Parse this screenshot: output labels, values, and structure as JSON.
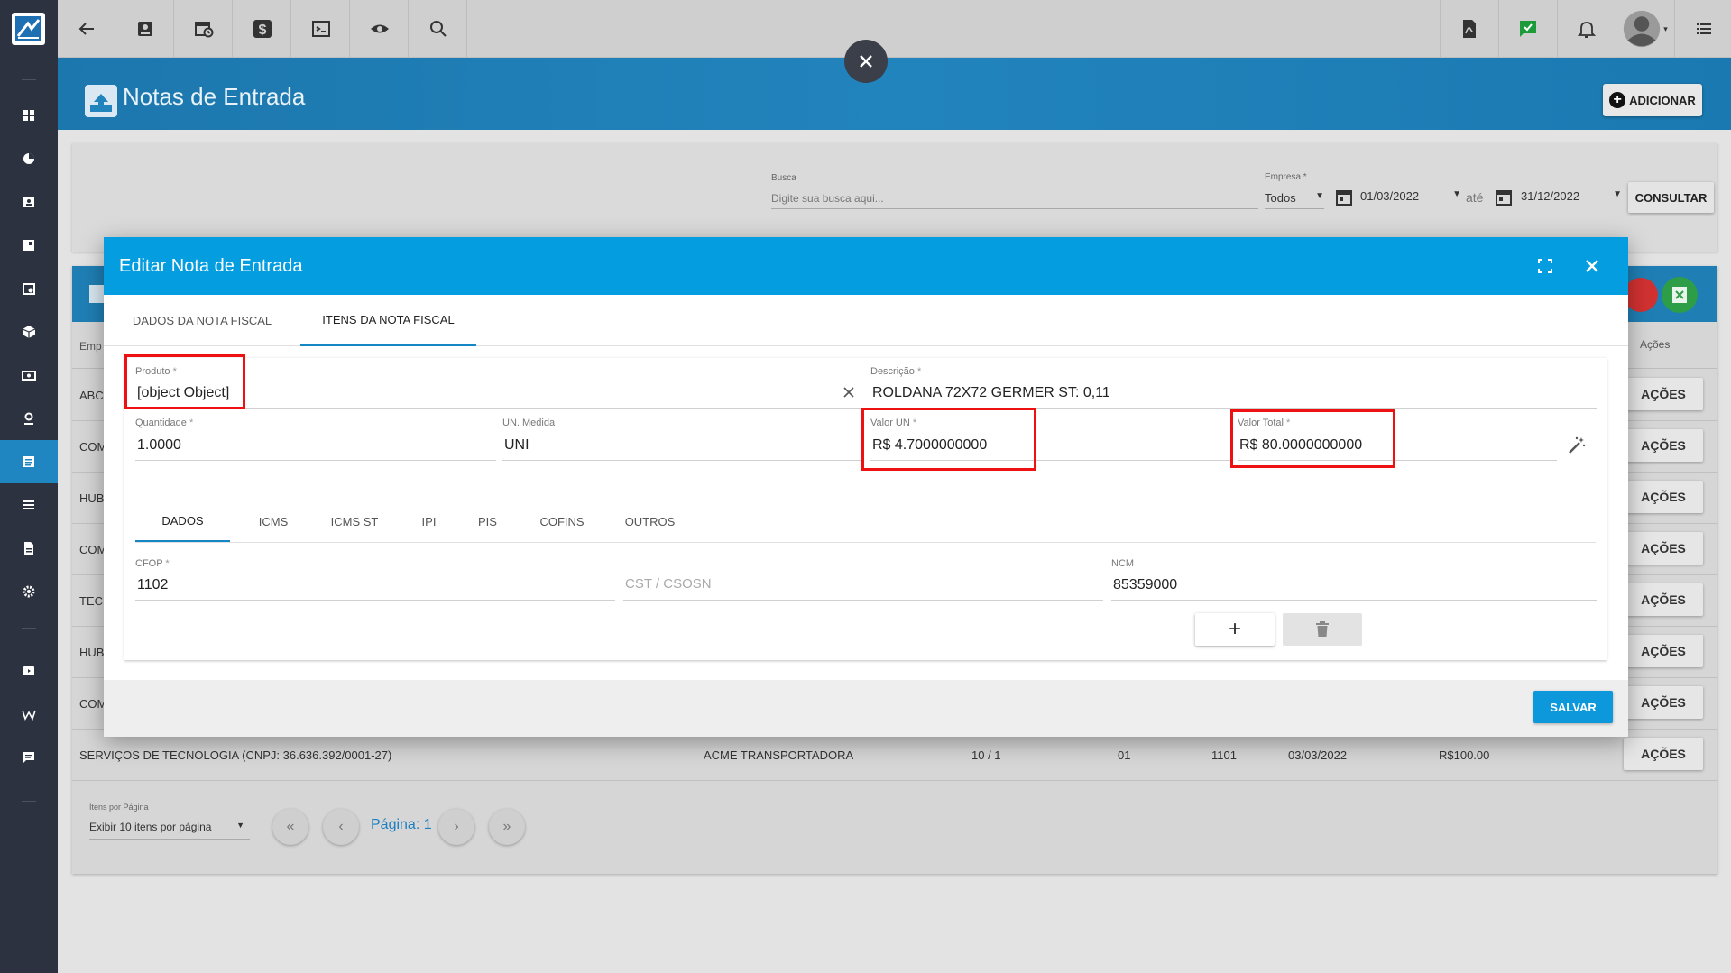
{
  "page": {
    "title": "Notas de Entrada",
    "add_label": "ADICIONAR"
  },
  "filters": {
    "busca_label": "Busca",
    "busca_placeholder": "Digite sua busca aqui...",
    "empresa_label": "Empresa *",
    "empresa_value": "Todos",
    "date_from": "01/03/2022",
    "ate_label": "até",
    "date_to": "31/12/2022",
    "consult_label": "CONSULTAR"
  },
  "list": {
    "col_emp": "Emp",
    "col_acoes": "Ações",
    "rows": [
      {
        "emp": "ABC"
      },
      {
        "emp": "COM"
      },
      {
        "emp": "HUB"
      },
      {
        "emp": "COM"
      },
      {
        "emp": "TEC"
      },
      {
        "emp": "HUB"
      },
      {
        "emp": "COM"
      }
    ],
    "full_row": {
      "empresa": "SERVIÇOS DE TECNOLOGIA (CNPJ: 36.636.392/0001-27)",
      "transportadora": "ACME TRANSPORTADORA",
      "numero": "10 / 1",
      "serie": "01",
      "cfop": "1101",
      "data": "03/03/2022",
      "valor": "R$100.00"
    },
    "acoes_label": "AÇÕES",
    "itens_por_pagina_label": "Itens por Página",
    "itens_por_pagina_value": "Exibir 10 itens por página",
    "pagina_label": "Página: 1"
  },
  "modal": {
    "title": "Editar Nota de Entrada",
    "tabs": [
      "DADOS DA NOTA FISCAL",
      "ITENS DA NOTA FISCAL"
    ],
    "produto_label": "Produto",
    "produto_value": "[object Object]",
    "descricao_label": "Descrição",
    "descricao_value": "ROLDANA 72X72 GERMER ST: 0,11",
    "quantidade_label": "Quantidade",
    "quantidade_value": "1.0000",
    "un_label": "UN. Medida",
    "un_value": "UNI",
    "valor_un_label": "Valor UN",
    "valor_un_value": "R$ 4.7000000000",
    "valor_total_label": "Valor Total",
    "valor_total_value": "R$ 80.0000000000",
    "req": "*",
    "subtabs": [
      "DADOS",
      "ICMS",
      "ICMS ST",
      "IPI",
      "PIS",
      "COFINS",
      "OUTROS"
    ],
    "cfop_label": "CFOP",
    "cfop_value": "1102",
    "cst_placeholder": "CST / CSOSN",
    "ncm_label": "NCM",
    "ncm_value": "85359000",
    "plus_label": "+",
    "salvar_label": "SALVAR"
  },
  "colors": {
    "sidebar": "#2c3240",
    "header": "#1f7fb5",
    "modal_header": "#049de0",
    "accent_blue": "#1687c6",
    "highlight_red": "#ee1111"
  }
}
